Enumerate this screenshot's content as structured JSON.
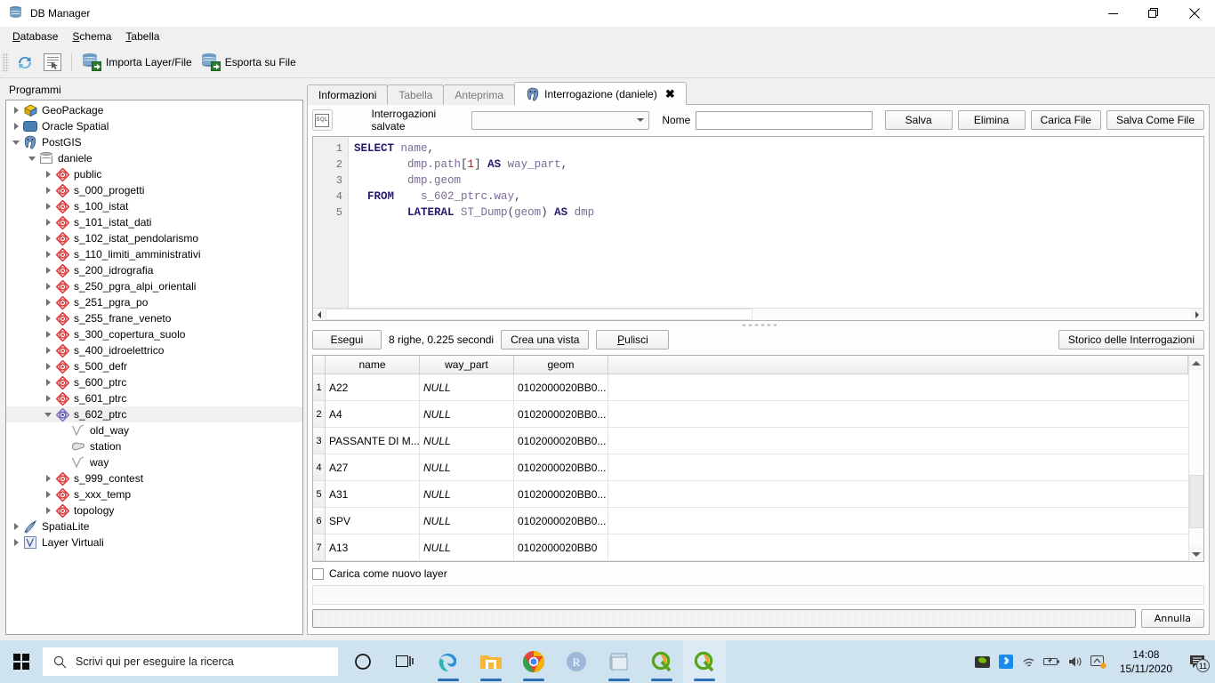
{
  "window": {
    "title": "DB Manager",
    "icon": "database-icon",
    "controls": {
      "minimize": "minimize-icon",
      "maximize": "maximize-icon",
      "close": "close-icon"
    }
  },
  "menubar": {
    "items": [
      {
        "label": "Database",
        "mnemonic": "D"
      },
      {
        "label": "Schema",
        "mnemonic": "S"
      },
      {
        "label": "Tabella",
        "mnemonic": "T"
      }
    ]
  },
  "toolbar": {
    "refresh_icon": "refresh-icon",
    "sql_window_icon": "sql-window-icon",
    "import_label": "Importa Layer/File",
    "export_label": "Esporta su File"
  },
  "sidebar": {
    "header": "Programmi",
    "items": [
      {
        "label": "GeoPackage",
        "icon": "geopackage-icon",
        "indent": 0,
        "state": "closed"
      },
      {
        "label": "Oracle Spatial",
        "icon": "oracle-icon",
        "indent": 0,
        "state": "closed"
      },
      {
        "label": "PostGIS",
        "icon": "postgis-icon",
        "indent": 0,
        "state": "open"
      },
      {
        "label": "daniele",
        "icon": "database-icon",
        "indent": 1,
        "state": "open"
      },
      {
        "label": "public",
        "icon": "schema-icon",
        "indent": 2,
        "state": "closed"
      },
      {
        "label": "s_000_progetti",
        "icon": "schema-icon",
        "indent": 2,
        "state": "closed"
      },
      {
        "label": "s_100_istat",
        "icon": "schema-icon",
        "indent": 2,
        "state": "closed"
      },
      {
        "label": "s_101_istat_dati",
        "icon": "schema-icon",
        "indent": 2,
        "state": "closed"
      },
      {
        "label": "s_102_istat_pendolarismo",
        "icon": "schema-icon",
        "indent": 2,
        "state": "closed"
      },
      {
        "label": "s_110_limiti_amministrativi",
        "icon": "schema-icon",
        "indent": 2,
        "state": "closed"
      },
      {
        "label": "s_200_idrografia",
        "icon": "schema-icon",
        "indent": 2,
        "state": "closed"
      },
      {
        "label": "s_250_pgra_alpi_orientali",
        "icon": "schema-icon",
        "indent": 2,
        "state": "closed"
      },
      {
        "label": "s_251_pgra_po",
        "icon": "schema-icon",
        "indent": 2,
        "state": "closed"
      },
      {
        "label": "s_255_frane_veneto",
        "icon": "schema-icon",
        "indent": 2,
        "state": "closed"
      },
      {
        "label": "s_300_copertura_suolo",
        "icon": "schema-icon",
        "indent": 2,
        "state": "closed"
      },
      {
        "label": "s_400_idroelettrico",
        "icon": "schema-icon",
        "indent": 2,
        "state": "closed"
      },
      {
        "label": "s_500_defr",
        "icon": "schema-icon",
        "indent": 2,
        "state": "closed"
      },
      {
        "label": "s_600_ptrc",
        "icon": "schema-icon",
        "indent": 2,
        "state": "closed"
      },
      {
        "label": "s_601_ptrc",
        "icon": "schema-icon",
        "indent": 2,
        "state": "closed"
      },
      {
        "label": "s_602_ptrc",
        "icon": "schema-icon",
        "indent": 2,
        "state": "open",
        "selected": true
      },
      {
        "label": "old_way",
        "icon": "line-layer-icon",
        "indent": 3,
        "state": "leaf"
      },
      {
        "label": "station",
        "icon": "polygon-layer-icon",
        "indent": 3,
        "state": "leaf"
      },
      {
        "label": "way",
        "icon": "line-layer-icon",
        "indent": 3,
        "state": "leaf"
      },
      {
        "label": "s_999_contest",
        "icon": "schema-icon",
        "indent": 2,
        "state": "closed"
      },
      {
        "label": "s_xxx_temp",
        "icon": "schema-icon",
        "indent": 2,
        "state": "closed"
      },
      {
        "label": "topology",
        "icon": "schema-icon",
        "indent": 2,
        "state": "closed"
      },
      {
        "label": "SpatiaLite",
        "icon": "spatialite-icon",
        "indent": 0,
        "state": "closed"
      },
      {
        "label": "Layer Virtuali",
        "icon": "virtual-layer-icon",
        "indent": 0,
        "state": "closed"
      }
    ]
  },
  "tabs": [
    {
      "label": "Informazioni",
      "active": false,
      "enabled": true
    },
    {
      "label": "Tabella",
      "active": false,
      "enabled": false
    },
    {
      "label": "Anteprima",
      "active": false,
      "enabled": false
    },
    {
      "label": "Interrogazione (daniele)",
      "active": true,
      "enabled": true,
      "icon": "postgis-icon",
      "closable": true,
      "close_glyph": "✖"
    }
  ],
  "query_toolbar": {
    "sql_icon": "sql-icon",
    "sql_glyph": "SQL",
    "saved_queries_label": "Interrogazioni salvate",
    "saved_queries_value": "",
    "name_label": "Nome",
    "name_value": "",
    "buttons": [
      {
        "label": "Salva",
        "name": "save-button"
      },
      {
        "label": "Elimina",
        "name": "delete-button"
      },
      {
        "label": "Carica File",
        "name": "load-file-button"
      },
      {
        "label": "Salva Come File",
        "name": "save-as-file-button"
      }
    ]
  },
  "editor": {
    "line_numbers": [
      "1",
      "2",
      "3",
      "4",
      "5"
    ],
    "lines": [
      [
        {
          "t": "SELECT",
          "c": "kw"
        },
        {
          "t": " ",
          "c": "pl"
        },
        {
          "t": "name",
          "c": "id"
        },
        {
          "t": ",",
          "c": "pl"
        }
      ],
      [
        {
          "t": "        ",
          "c": "pl"
        },
        {
          "t": "dmp.path",
          "c": "id"
        },
        {
          "t": "[",
          "c": "pl"
        },
        {
          "t": "1",
          "c": "num"
        },
        {
          "t": "]",
          "c": "pl"
        },
        {
          "t": " ",
          "c": "pl"
        },
        {
          "t": "AS",
          "c": "kw"
        },
        {
          "t": " ",
          "c": "pl"
        },
        {
          "t": "way_part",
          "c": "id"
        },
        {
          "t": ",",
          "c": "pl"
        }
      ],
      [
        {
          "t": "        ",
          "c": "pl"
        },
        {
          "t": "dmp.geom",
          "c": "id"
        }
      ],
      [
        {
          "t": "  ",
          "c": "pl"
        },
        {
          "t": "FROM",
          "c": "kw"
        },
        {
          "t": "    ",
          "c": "pl"
        },
        {
          "t": "s_602_ptrc.way",
          "c": "id"
        },
        {
          "t": ",",
          "c": "pl"
        }
      ],
      [
        {
          "t": "        ",
          "c": "pl"
        },
        {
          "t": "LATERAL",
          "c": "kw"
        },
        {
          "t": " ",
          "c": "pl"
        },
        {
          "t": "ST_Dump",
          "c": "id"
        },
        {
          "t": "(",
          "c": "pl"
        },
        {
          "t": "geom",
          "c": "id"
        },
        {
          "t": ")",
          "c": "pl"
        },
        {
          "t": " ",
          "c": "pl"
        },
        {
          "t": "AS",
          "c": "kw"
        },
        {
          "t": " ",
          "c": "pl"
        },
        {
          "t": "dmp",
          "c": "id"
        }
      ]
    ],
    "plain_text": "SELECT name,\n        dmp.path[1] AS way_part,\n        dmp.geom\n  FROM    s_602_ptrc.way,\n        LATERAL ST_Dump(geom) AS dmp"
  },
  "run_bar": {
    "execute_label": "Esegui",
    "status": "8 righe, 0.225 secondi",
    "create_view_label": "Crea una vista",
    "clear_label": "Pulisci",
    "clear_mnemonic": "P",
    "history_label": "Storico delle Interrogazioni"
  },
  "results": {
    "columns": [
      "name",
      "way_part",
      "geom"
    ],
    "rows": [
      {
        "num": "1",
        "name": "A22",
        "way_part": "NULL",
        "geom": "0102000020BB0..."
      },
      {
        "num": "2",
        "name": "A4",
        "way_part": "NULL",
        "geom": "0102000020BB0..."
      },
      {
        "num": "3",
        "name": "PASSANTE DI M...",
        "way_part": "NULL",
        "geom": "0102000020BB0..."
      },
      {
        "num": "4",
        "name": "A27",
        "way_part": "NULL",
        "geom": "0102000020BB0..."
      },
      {
        "num": "5",
        "name": "A31",
        "way_part": "NULL",
        "geom": "0102000020BB0..."
      },
      {
        "num": "6",
        "name": "SPV",
        "way_part": "NULL",
        "geom": "0102000020BB0..."
      },
      {
        "num": "7",
        "name": "A13",
        "way_part": "NULL",
        "geom": "0102000020BB0"
      }
    ]
  },
  "footer": {
    "load_as_layer_label": "Carica come nuovo layer",
    "load_as_layer_checked": false,
    "status_text": "",
    "cancel_label": "Annulla"
  },
  "taskbar": {
    "start_icon": "windows-start-icon",
    "search_placeholder": "Scrivi qui per eseguire la ricerca",
    "search_icon": "search-icon",
    "items": [
      {
        "name": "cortana-icon",
        "label": ""
      },
      {
        "name": "task-view-icon",
        "label": ""
      },
      {
        "name": "edge-icon",
        "label": "",
        "running": true
      },
      {
        "name": "file-explorer-icon",
        "label": "",
        "running": true
      },
      {
        "name": "chrome-icon",
        "label": "",
        "running": true
      },
      {
        "name": "r-studio-icon",
        "label": ""
      },
      {
        "name": "notepad-icon",
        "label": "",
        "running": true
      },
      {
        "name": "qgis-icon",
        "label": "",
        "running": true
      },
      {
        "name": "qgis-icon-2",
        "label": "",
        "running": true,
        "active": true
      }
    ],
    "tray": [
      {
        "name": "nvidia-icon"
      },
      {
        "name": "bluetooth-icon"
      },
      {
        "name": "wifi-icon"
      },
      {
        "name": "battery-icon"
      },
      {
        "name": "volume-icon"
      },
      {
        "name": "onedrive-sync-icon"
      }
    ],
    "time": "14:08",
    "date": "15/11/2020",
    "notification_count": "11"
  },
  "colors": {
    "accent": "#2a6fb5",
    "taskbar_bg": "#cfe2ef",
    "keyword": "#2a1a6e",
    "identifier": "#7a6a96",
    "number": "#d00000",
    "schema_icon": "#e03a3a"
  }
}
